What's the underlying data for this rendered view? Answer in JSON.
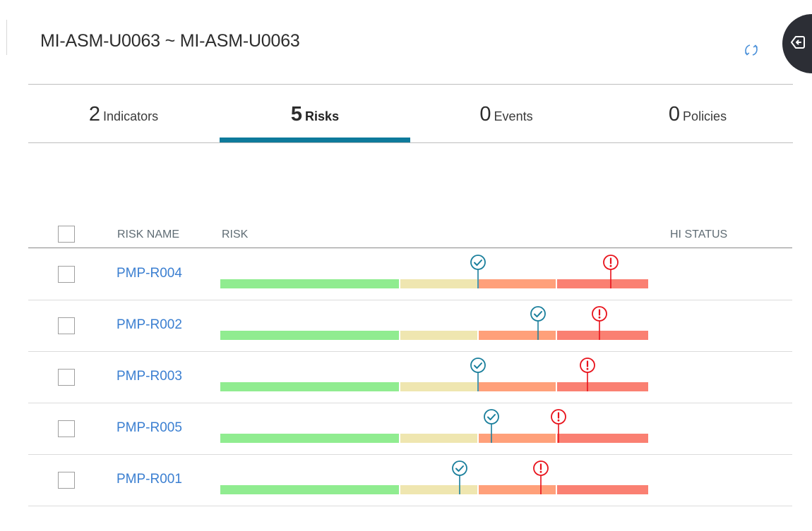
{
  "page": {
    "title": "MI-ASM-U0063 ~ MI-ASM-U0063",
    "refresh_icon": "refresh-icon",
    "side_toggle_icon": "panel-toggle-icon"
  },
  "tabs": [
    {
      "count": "2",
      "label": "Indicators",
      "active": false
    },
    {
      "count": "5",
      "label": "Risks",
      "active": true
    },
    {
      "count": "0",
      "label": "Events",
      "active": false
    },
    {
      "count": "0",
      "label": "Policies",
      "active": false
    }
  ],
  "table": {
    "columns": {
      "risk_name": "RISK NAME",
      "risk": "RISK",
      "hi_status": "HI STATUS"
    },
    "segment_colors": [
      "#90ec90",
      "#efe6b0",
      "#ffa07a",
      "#fa8072"
    ],
    "marker_colors": {
      "check": "#1a7f9c",
      "alert": "#e8121b"
    },
    "rows": [
      {
        "name": "PMP-R004",
        "check_pos": 0.602,
        "alert_pos": 0.913
      },
      {
        "name": "PMP-R002",
        "check_pos": 0.742,
        "alert_pos": 0.886
      },
      {
        "name": "PMP-R003",
        "check_pos": 0.602,
        "alert_pos": 0.858
      },
      {
        "name": "PMP-R005",
        "check_pos": 0.634,
        "alert_pos": 0.79
      },
      {
        "name": "PMP-R001",
        "check_pos": 0.559,
        "alert_pos": 0.749
      }
    ]
  }
}
